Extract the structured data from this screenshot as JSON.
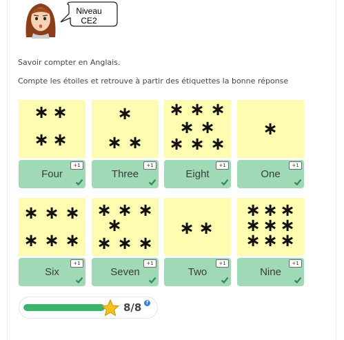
{
  "header": {
    "level_line1": "Niveau",
    "level_line2": "CE2"
  },
  "instructions": {
    "title": "Savoir compter en Anglais.",
    "subtitle": "Compte les étoiles et retrouve à partir des étiquettes la bonne réponse"
  },
  "cards": [
    {
      "label": "Four",
      "star_count": 4,
      "badge": "+1"
    },
    {
      "label": "Three",
      "star_count": 3,
      "badge": "+1"
    },
    {
      "label": "Eight",
      "star_count": 8,
      "badge": "+1"
    },
    {
      "label": "One",
      "star_count": 1,
      "badge": "+1"
    },
    {
      "label": "Six",
      "star_count": 6,
      "badge": "+1"
    },
    {
      "label": "Seven",
      "star_count": 7,
      "badge": "+1"
    },
    {
      "label": "Two",
      "star_count": 2,
      "badge": "+1"
    },
    {
      "label": "Nine",
      "star_count": 9,
      "badge": "+1"
    }
  ],
  "score": {
    "text": "8/8",
    "progress": 1.0,
    "help": "?"
  },
  "colors": {
    "star_box": "#fdfcb1",
    "label_bg": "#9fd9b6",
    "check": "#2f8a57",
    "progress": "#3bb56d"
  }
}
